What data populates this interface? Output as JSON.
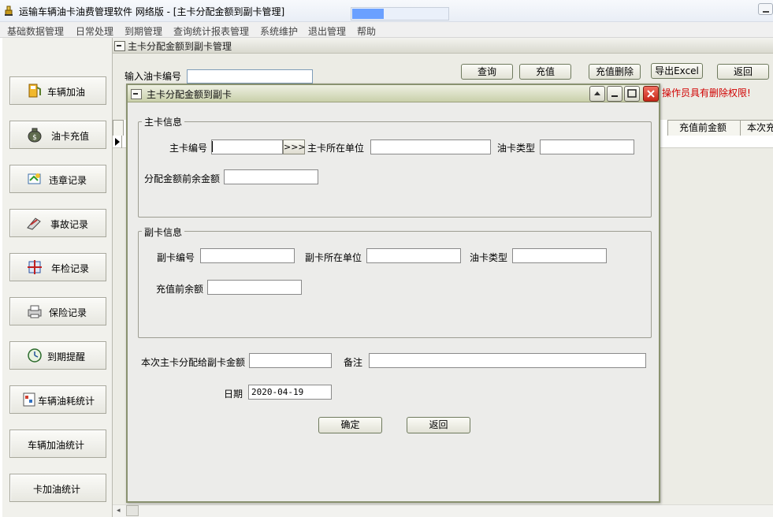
{
  "window": {
    "title": "运输车辆油卡油费管理软件  网络版  - [主卡分配金额到副卡管理]"
  },
  "menu": [
    "基础数据管理",
    "日常处理",
    "到期管理",
    "查询统计报表管理",
    "系统维护",
    "退出管理",
    "帮助"
  ],
  "sidebar": {
    "items": [
      {
        "label": "车辆加油",
        "icon": "fuel-pump-icon"
      },
      {
        "label": "油卡充值",
        "icon": "money-bag-icon"
      },
      {
        "label": "违章记录",
        "icon": "violation-icon"
      },
      {
        "label": "事故记录",
        "icon": "accident-icon"
      },
      {
        "label": "年检记录",
        "icon": "inspection-icon"
      },
      {
        "label": "保险记录",
        "icon": "printer-icon"
      },
      {
        "label": "到期提醒",
        "icon": "clock-icon"
      },
      {
        "label": "车辆油耗统计",
        "icon": "chart-icon"
      },
      {
        "label": "车辆加油统计",
        "icon": ""
      },
      {
        "label": "卡加油统计",
        "icon": ""
      }
    ]
  },
  "background_window": {
    "title": "主卡分配金额到副卡管理",
    "search_label": "输入油卡编号",
    "search_value": "",
    "buttons": {
      "query": "查询",
      "recharge": "充值",
      "recharge_delete": "充值删除",
      "export": "导出Excel",
      "back": "返回"
    },
    "permission_notice": "操作员具有删除权限!",
    "table_headers": [
      "充值前金额",
      "本次充"
    ]
  },
  "dialog": {
    "title": "主卡分配金额到副卡",
    "main_card": {
      "group_label": "主卡信息",
      "card_no_label": "主卡编号",
      "card_no": "",
      "lookup_label": ">>>",
      "unit_label": "主卡所在单位",
      "unit": "",
      "card_type_label": "油卡类型",
      "card_type": "",
      "balance_label": "分配金额前余金额",
      "balance": ""
    },
    "sub_card": {
      "group_label": "副卡信息",
      "card_no_label": "副卡编号",
      "card_no": "",
      "unit_label": "副卡所在单位",
      "unit": "",
      "card_type_label": "油卡类型",
      "card_type": "",
      "balance_label": "充值前余额",
      "balance": ""
    },
    "amount_label": "本次主卡分配给副卡金额",
    "amount": "",
    "remark_label": "备注",
    "remark": "",
    "date_label": "日期",
    "date": "2020-04-19",
    "confirm_label": "确定",
    "back_label": "返回"
  }
}
